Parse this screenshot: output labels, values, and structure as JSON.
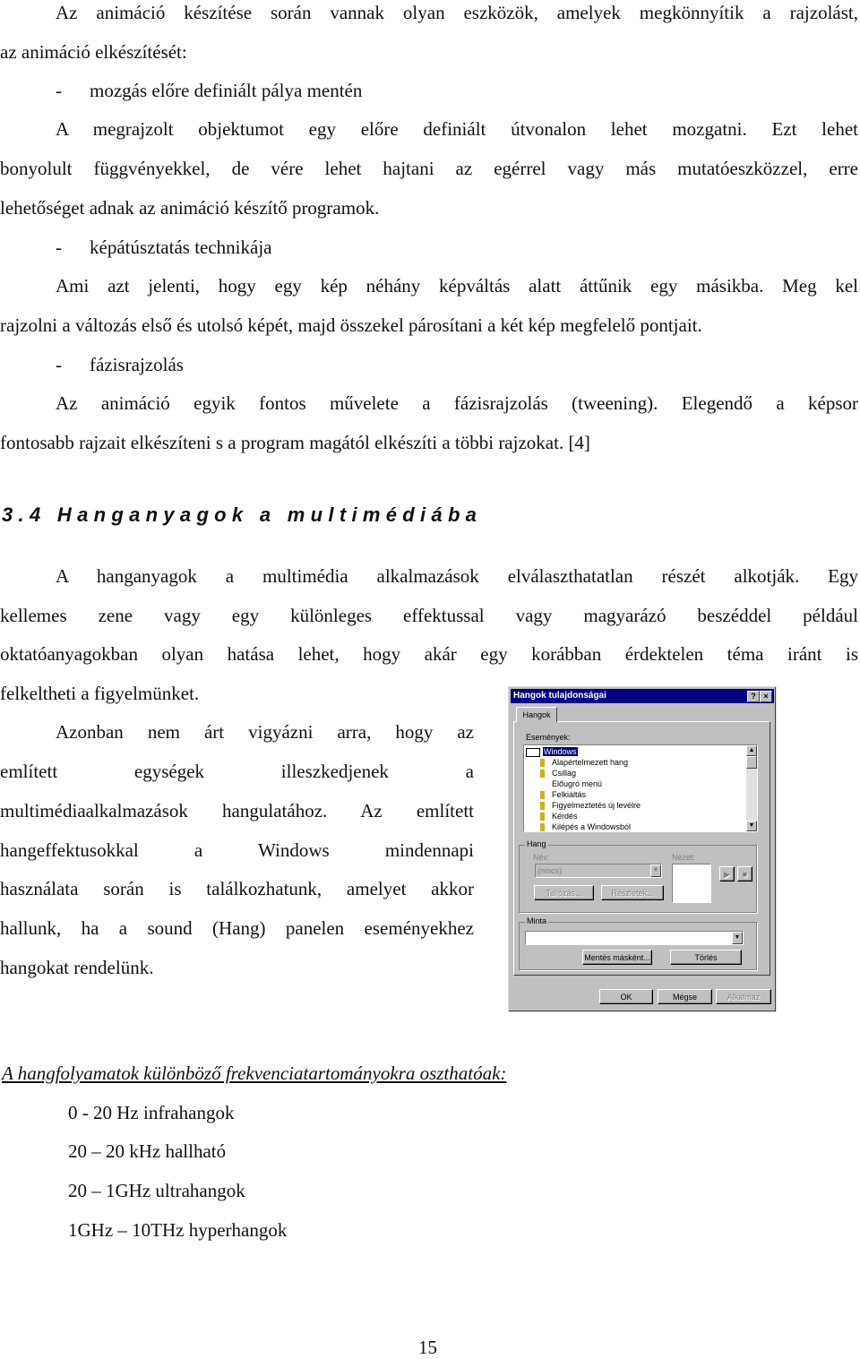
{
  "paragraphs": {
    "p1": [
      "Az animáció készítése során vannak olyan eszközök, amelyek megkönnyítik a rajzolást,",
      "az animáció elkészítését:"
    ],
    "bullet1": {
      "dash": "-",
      "text": "mozgás előre definiált pálya mentén"
    },
    "p2": [
      "A megrajzolt objektumot egy előre definiált útvonalon lehet mozgatni. Ezt lehet",
      "bonyolult függvényekkel, de vére lehet hajtani az egérrel vagy más mutatóeszközzel, erre",
      "lehetőséget adnak az animáció készítő programok."
    ],
    "bullet2": {
      "dash": "-",
      "text": "képátúsztatás technikája"
    },
    "p3": [
      "Ami azt jelenti, hogy egy kép néhány képváltás alatt áttűnik egy másikba. Meg kel",
      "rajzolni a változás első és utolsó képét, majd összekel párosítani a két kép megfelelő pontjait."
    ],
    "bullet3": {
      "dash": "-",
      "text": "fázisrajzolás"
    },
    "p4": [
      "Az animáció egyik fontos művelete a fázisrajzolás (tweening). Elegendő a képsor",
      "fontosabb rajzait elkészíteni s a program magától elkészíti a többi rajzokat. [4]"
    ]
  },
  "section_heading": "3.4 Hanganyagok a multimédiába",
  "section": {
    "p5": [
      "A hanganyagok a multimédia alkalmazások elválaszthatatlan részét alkotják. Egy",
      "kellemes zene vagy egy különleges effektussal vagy magyarázó beszéddel például",
      "oktatóanyagokban olyan hatása lehet, hogy akár egy korábban érdektelen téma iránt is",
      "felkeltheti a figyelmünket."
    ],
    "p6": [
      "Azonban nem árt vigyázni arra, hogy az",
      "említett egységek illeszkedjenek a",
      "multimédiaalkalmazások hangulatához. Az említett",
      "hangeffektusokkal a Windows mindennapi",
      "használata során is találkozhatunk, amelyet akkor",
      "hallunk, ha a sound (Hang) panelen eseményekhez",
      "hangokat rendelünk."
    ]
  },
  "dialog": {
    "title": "Hangok tulajdonságai",
    "help_btn": "?",
    "close_btn": "×",
    "tab": "Hangok",
    "events_label": "Események:",
    "events": [
      "Windows",
      "Alapértelmezett hang",
      "Csillag",
      "Előugró menü",
      "Felkiáltás",
      "Figyelmeztetés új levélre",
      "Kérdés",
      "Kilépés a Windowsból"
    ],
    "hang_group": "Hang",
    "name_label": "Név:",
    "name_value": "(nincs)",
    "preview_label": "Nézet:",
    "browse_btn": "Tallózás...",
    "details_btn": "Részletek...",
    "play_btn": "▶",
    "stop_btn": "■",
    "scheme_group": "Minta",
    "scheme_value": "",
    "save_as_btn": "Mentés másként...",
    "delete_btn": "Törlés",
    "ok_btn": "OK",
    "cancel_btn": "Mégse",
    "apply_btn": "Alkalmaz"
  },
  "freq_heading": "A hangfolyamatok különböző frekvenciatartományokra oszthatóak:",
  "freq_list": [
    "0 - 20 Hz infrahangok",
    "20 – 20 kHz hallható",
    "20 – 1GHz ultrahangok",
    "1GHz – 10THz hyperhangok"
  ],
  "page_number": "15"
}
